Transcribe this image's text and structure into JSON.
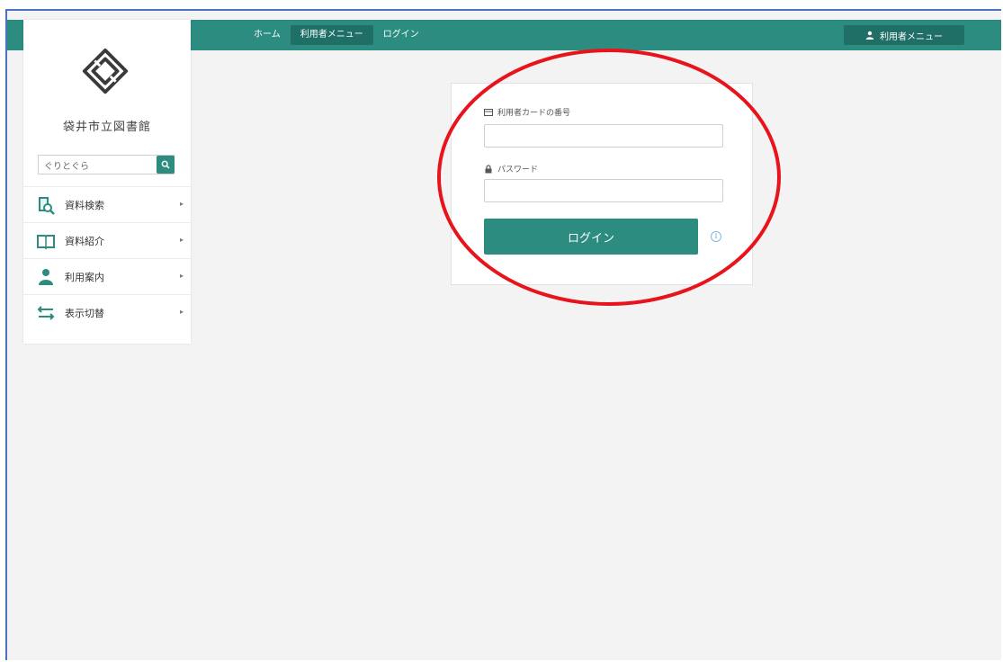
{
  "nav": {
    "crumbs": [
      {
        "label": "ホーム"
      },
      {
        "label": "利用者メニュー"
      },
      {
        "label": "ログイン"
      }
    ],
    "user_menu_label": "利用者メニュー"
  },
  "sidebar": {
    "library_name": "袋井市立図書館",
    "search": {
      "value": "ぐりとぐら"
    },
    "menu": [
      {
        "label": "資料検索",
        "icon": "book-search-icon"
      },
      {
        "label": "資料紹介",
        "icon": "open-book-icon"
      },
      {
        "label": "利用案内",
        "icon": "person-icon"
      },
      {
        "label": "表示切替",
        "icon": "switch-arrows-icon"
      }
    ]
  },
  "login": {
    "card_label": "利用者カードの番号",
    "password_label": "パスワード",
    "button_label": "ログイン",
    "info_glyph": "i"
  },
  "colors": {
    "accent": "#2c8c80",
    "accent_dark": "#1f6f66",
    "annotation": "#e8141c",
    "frame_border": "#4a72c4"
  }
}
